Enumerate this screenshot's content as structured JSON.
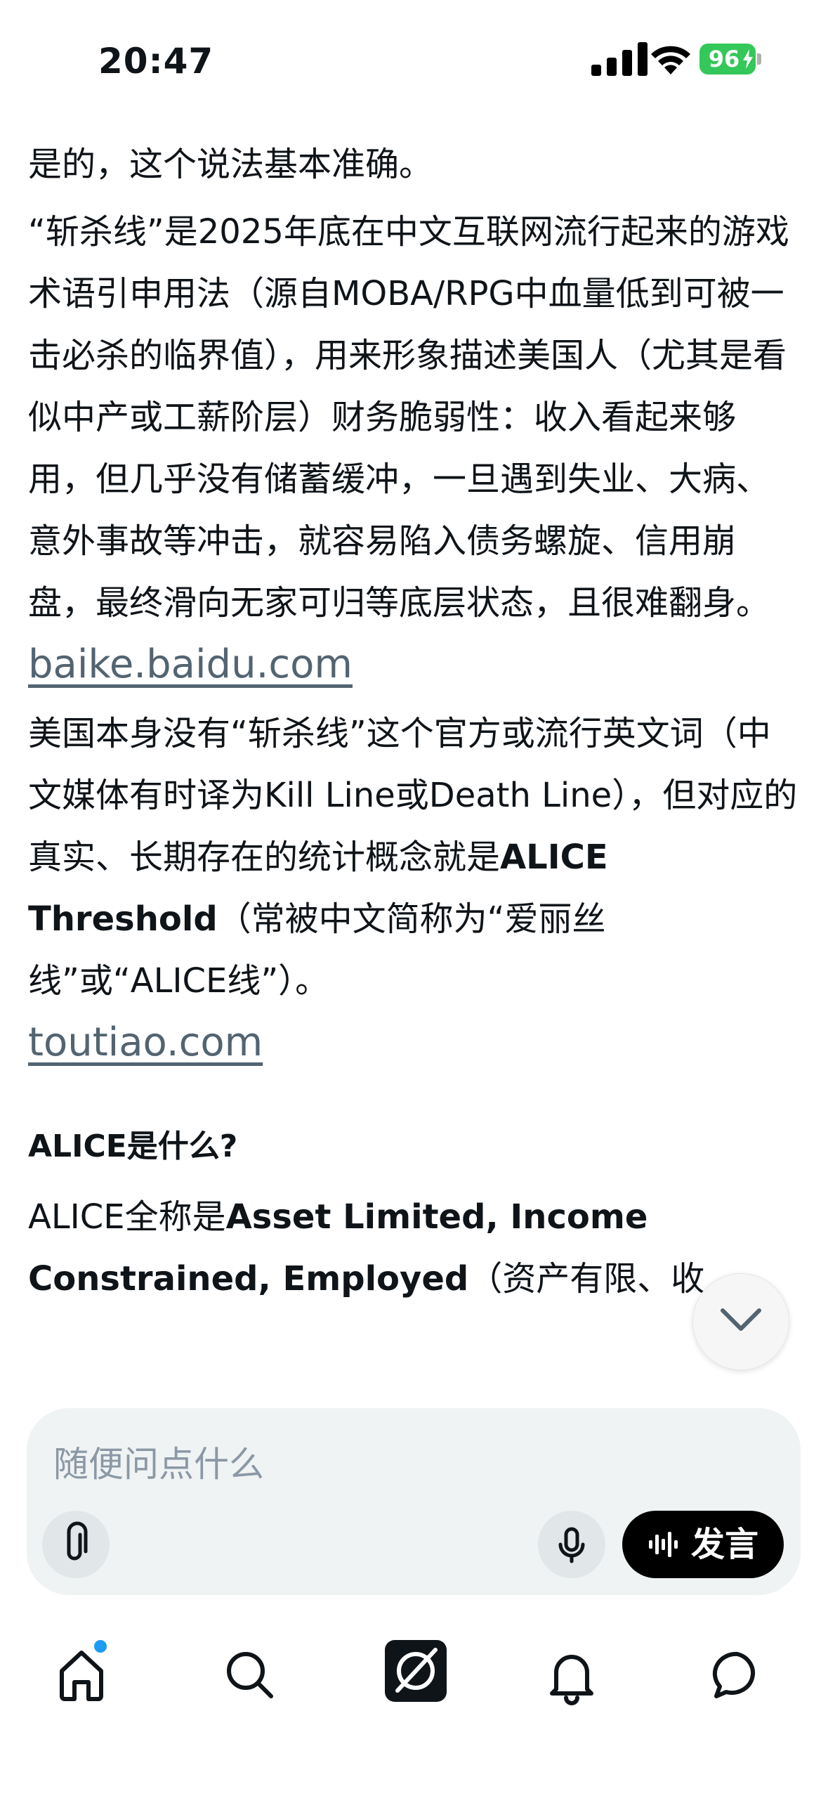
{
  "status_bar": {
    "time": "20:47",
    "battery": "96"
  },
  "content": {
    "p1": "是的，这个说法基本准确。",
    "p2": "“斩杀线”是2025年底在中文互联网流行起来的游戏术语引申用法（源自MOBA/RPG中血量低到可被一击必杀的临界值），用来形象描述美国人（尤其是看似中产或工薪阶层）财务脆弱性：收入看起来够用，但几乎没有储蓄缓冲，一旦遇到失业、大病、意外事故等冲击，就容易陷入债务螺旋、信用崩盘，最终滑向无家可归等底层状态，且很难翻身。",
    "p2_link": "baike.baidu.com",
    "p3_a": "美国本身没有“斩杀线”这个官方或流行英文词（中文媒体有时译为Kill Line或Death Line），但对应的真实、长期存在的统计概念就是",
    "p3_bold": "ALICE Threshold",
    "p3_b": "（常被中文简称为“爱丽丝线”或“ALICE线”）。",
    "p3_link": "toutiao.com",
    "heading": "ALICE是什么?",
    "p4_a": "ALICE全称是",
    "p4_bold": "Asset Limited, Income Constrained, Employed",
    "p4_b": "（资产有限、收"
  },
  "composer": {
    "placeholder": "随便问点什么",
    "speak_label": "发言"
  },
  "nav": {
    "items": [
      "home-icon",
      "search-icon",
      "grok-icon",
      "notifications-icon",
      "messages-icon"
    ],
    "accent": "#1d9bf0"
  }
}
